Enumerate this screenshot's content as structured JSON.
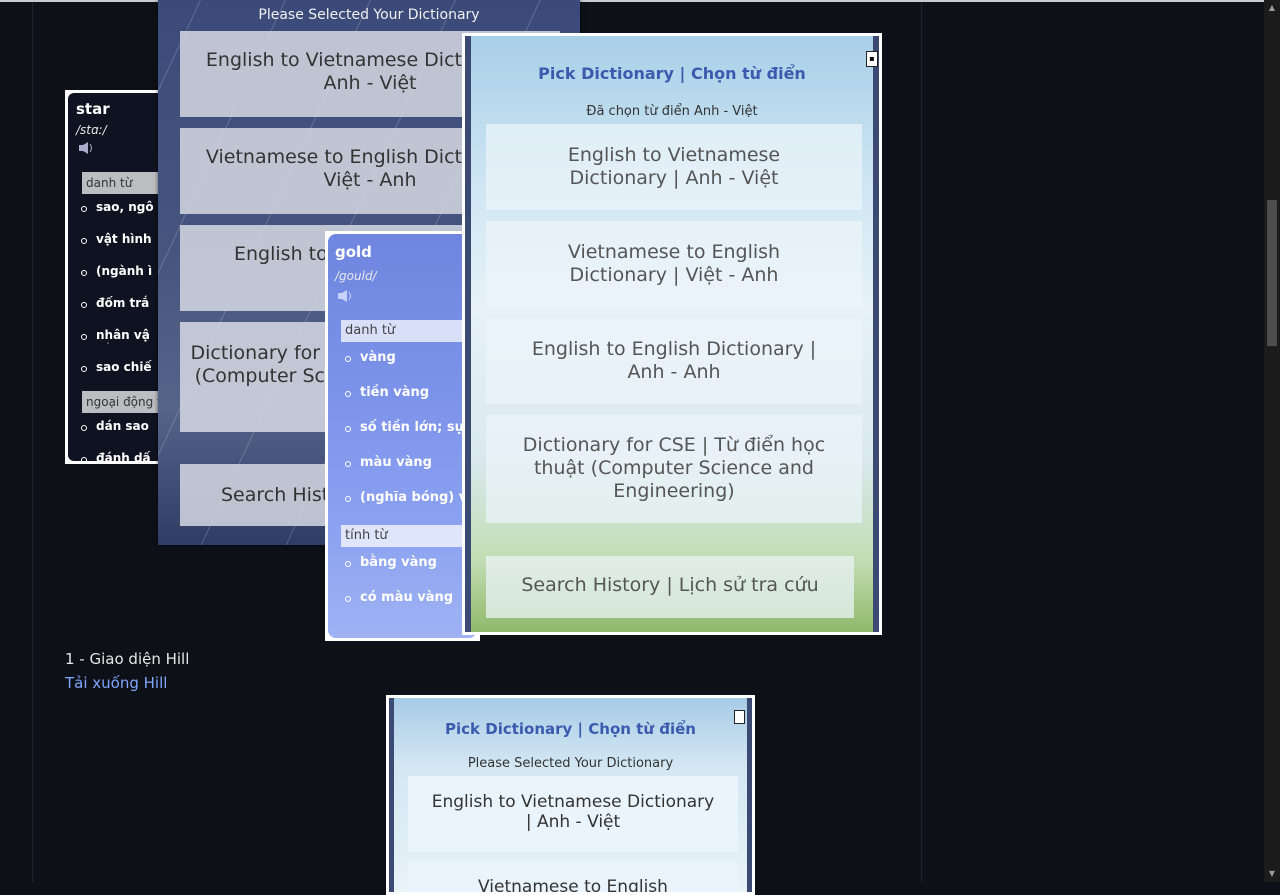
{
  "star_popup": {
    "word": "star",
    "phonetic": "/stɑː/",
    "pos1": "danh từ",
    "defs1": [
      "sao, ngô",
      "vật hình",
      "(ngành ì",
      "đốm trắ",
      "nhân vậ",
      "sao chiế"
    ],
    "pos2": "ngoại động t",
    "defs2": [
      "dán sao",
      "đánh dấ"
    ]
  },
  "rain_picker": {
    "title": "Please Selected Your Dictionary",
    "buttons": [
      "English to Vietnamese Dictionary | Anh - Việt",
      "Vietnamese to English Dictionary | Việt - Anh",
      "English to",
      "Dictionary for CSE | Từ điển học thuật (Computer Science and Engineering)",
      "Search History"
    ]
  },
  "gold_popup": {
    "word": "gold",
    "phonetic": "/gould/",
    "pos1": "danh từ",
    "defs1": [
      "vàng",
      "tiền vàng",
      "số tiền lớn; sự",
      "màu vàng",
      "(nghĩa bóng) v"
    ],
    "pos2": "tính từ",
    "defs2": [
      "bằng vàng",
      "có màu vàng"
    ]
  },
  "sky_picker": {
    "title": "Pick Dictionary | Chọn từ điển",
    "subtitle": "Đã chọn từ điển Anh - Việt",
    "buttons": [
      "English to Vietnamese Dictionary | Anh - Việt",
      "Vietnamese to English Dictionary | Việt - Anh",
      "English to English Dictionary | Anh - Anh",
      "Dictionary for CSE | Từ điển học thuật (Computer Science and Engineering)",
      "Search History | Lịch sử tra cứu"
    ]
  },
  "caption": "1 - Giao diện Hill",
  "download_link": "Tải xuống Hill",
  "bottom_picker": {
    "title": "Pick Dictionary | Chọn từ điển",
    "subtitle": "Please Selected Your Dictionary",
    "buttons": [
      "English to Vietnamese Dictionary | Anh - Việt",
      "Vietnamese to English"
    ]
  },
  "colors": {
    "page_bg": "#0d1117",
    "link": "#7fa5ff",
    "picker_title": "#3a5aae"
  }
}
